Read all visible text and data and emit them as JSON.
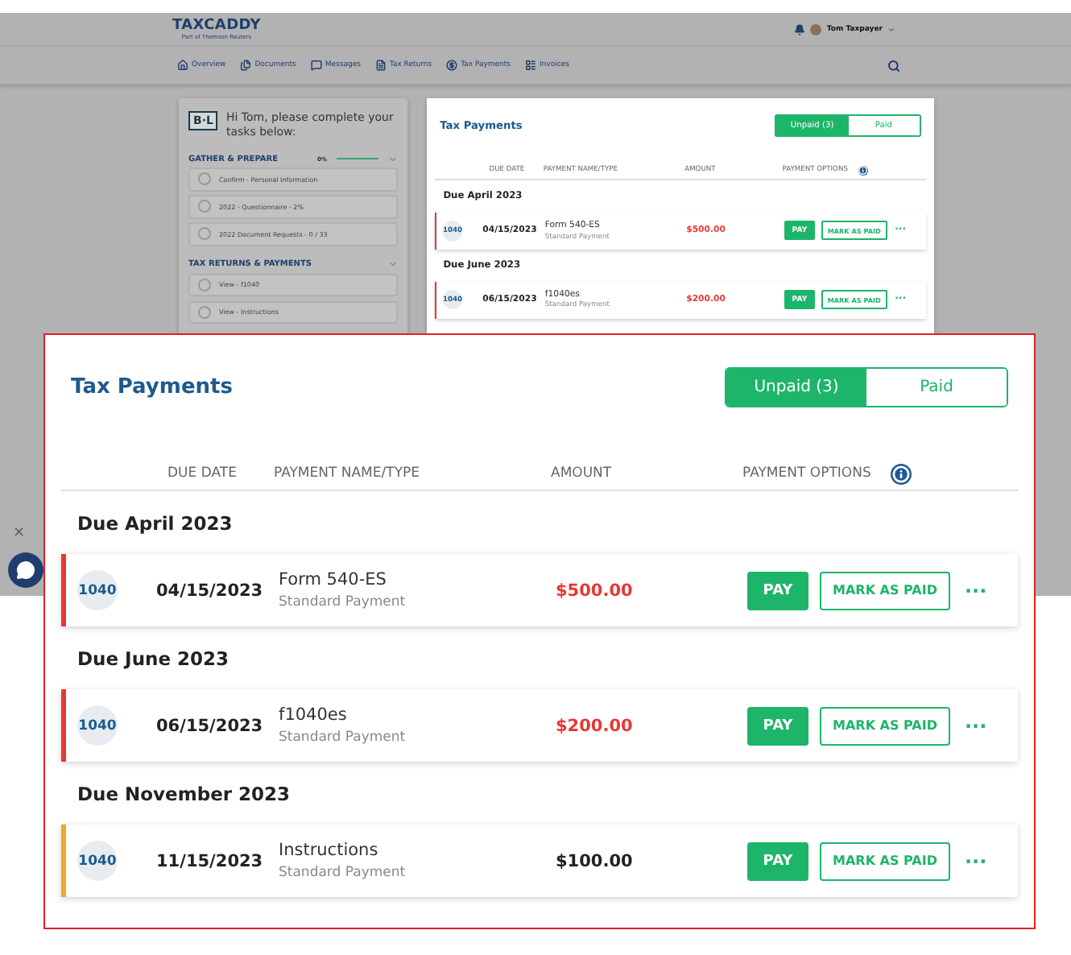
{
  "app": {
    "logo": {
      "name": "TAXCADDY",
      "tagline": "Part of Thomson Reuters"
    },
    "user": "Tom Taxpayer",
    "nav": [
      "Overview",
      "Documents",
      "Messages",
      "Tax Returns",
      "Tax Payments",
      "Invoices"
    ],
    "tasks": {
      "badge": "B·L",
      "greeting": "Hi Tom, please complete your tasks below:",
      "sections": [
        {
          "title": "GATHER & PREPARE",
          "progress": "0%",
          "items": [
            "Confirm - Personal Information",
            "2022 - Questionnaire - 2%",
            "2022 Document Requests - 0 / 33"
          ]
        },
        {
          "title": "TAX RETURNS & PAYMENTS",
          "items": [
            "View - f1040",
            "View - Instructions"
          ]
        }
      ]
    },
    "payments": {
      "title": "Tax Payments",
      "toggle": [
        {
          "label": "Unpaid (3)",
          "selected": true
        },
        {
          "label": "Paid",
          "selected": false
        }
      ],
      "columns": [
        "DUE DATE",
        "PAYMENT NAME/TYPE",
        "AMOUNT",
        "PAYMENT OPTIONS"
      ],
      "groups": [
        {
          "title": "Due April 2023",
          "rows": [
            {
              "form": "1040",
              "date": "04/15/2023",
              "name": "Form 540-ES",
              "type": "Standard Payment",
              "amount": "$500.00",
              "overdue": true,
              "color": "#e53935",
              "pay": "PAY",
              "mark": "MARK AS PAID",
              "more": "···"
            }
          ]
        },
        {
          "title": "Due June 2023",
          "rows": [
            {
              "form": "1040",
              "date": "06/15/2023",
              "name": "f1040es",
              "type": "Standard Payment",
              "amount": "$200.00",
              "overdue": true,
              "color": "#e53935",
              "pay": "PAY",
              "mark": "MARK AS PAID",
              "more": "···"
            }
          ]
        }
      ]
    },
    "chat": {
      "close": "×"
    }
  },
  "callout": {
    "title": "Tax Payments",
    "toggle": [
      {
        "label": "Unpaid (3)",
        "selected": true
      },
      {
        "label": "Paid",
        "selected": false
      }
    ],
    "columns": [
      "DUE DATE",
      "PAYMENT NAME/TYPE",
      "AMOUNT",
      "PAYMENT OPTIONS"
    ],
    "groups": [
      {
        "title": "Due April 2023",
        "rows": [
          {
            "form": "1040",
            "date": "04/15/2023",
            "name": "Form 540-ES",
            "type": "Standard Payment",
            "amount": "$500.00",
            "overdue": true,
            "color": "#e53935",
            "pay": "PAY",
            "mark": "MARK AS PAID",
            "more": "···"
          }
        ]
      },
      {
        "title": "Due June 2023",
        "rows": [
          {
            "form": "1040",
            "date": "06/15/2023",
            "name": "f1040es",
            "type": "Standard Payment",
            "amount": "$200.00",
            "overdue": true,
            "color": "#e53935",
            "pay": "PAY",
            "mark": "MARK AS PAID",
            "more": "···"
          }
        ]
      },
      {
        "title": "Due November 2023",
        "rows": [
          {
            "form": "1040",
            "date": "11/15/2023",
            "name": "Instructions",
            "type": "Standard Payment",
            "amount": "$100.00",
            "overdue": false,
            "color": "#f5a623",
            "pay": "PAY",
            "mark": "MARK AS PAID",
            "more": "···"
          }
        ]
      }
    ]
  }
}
